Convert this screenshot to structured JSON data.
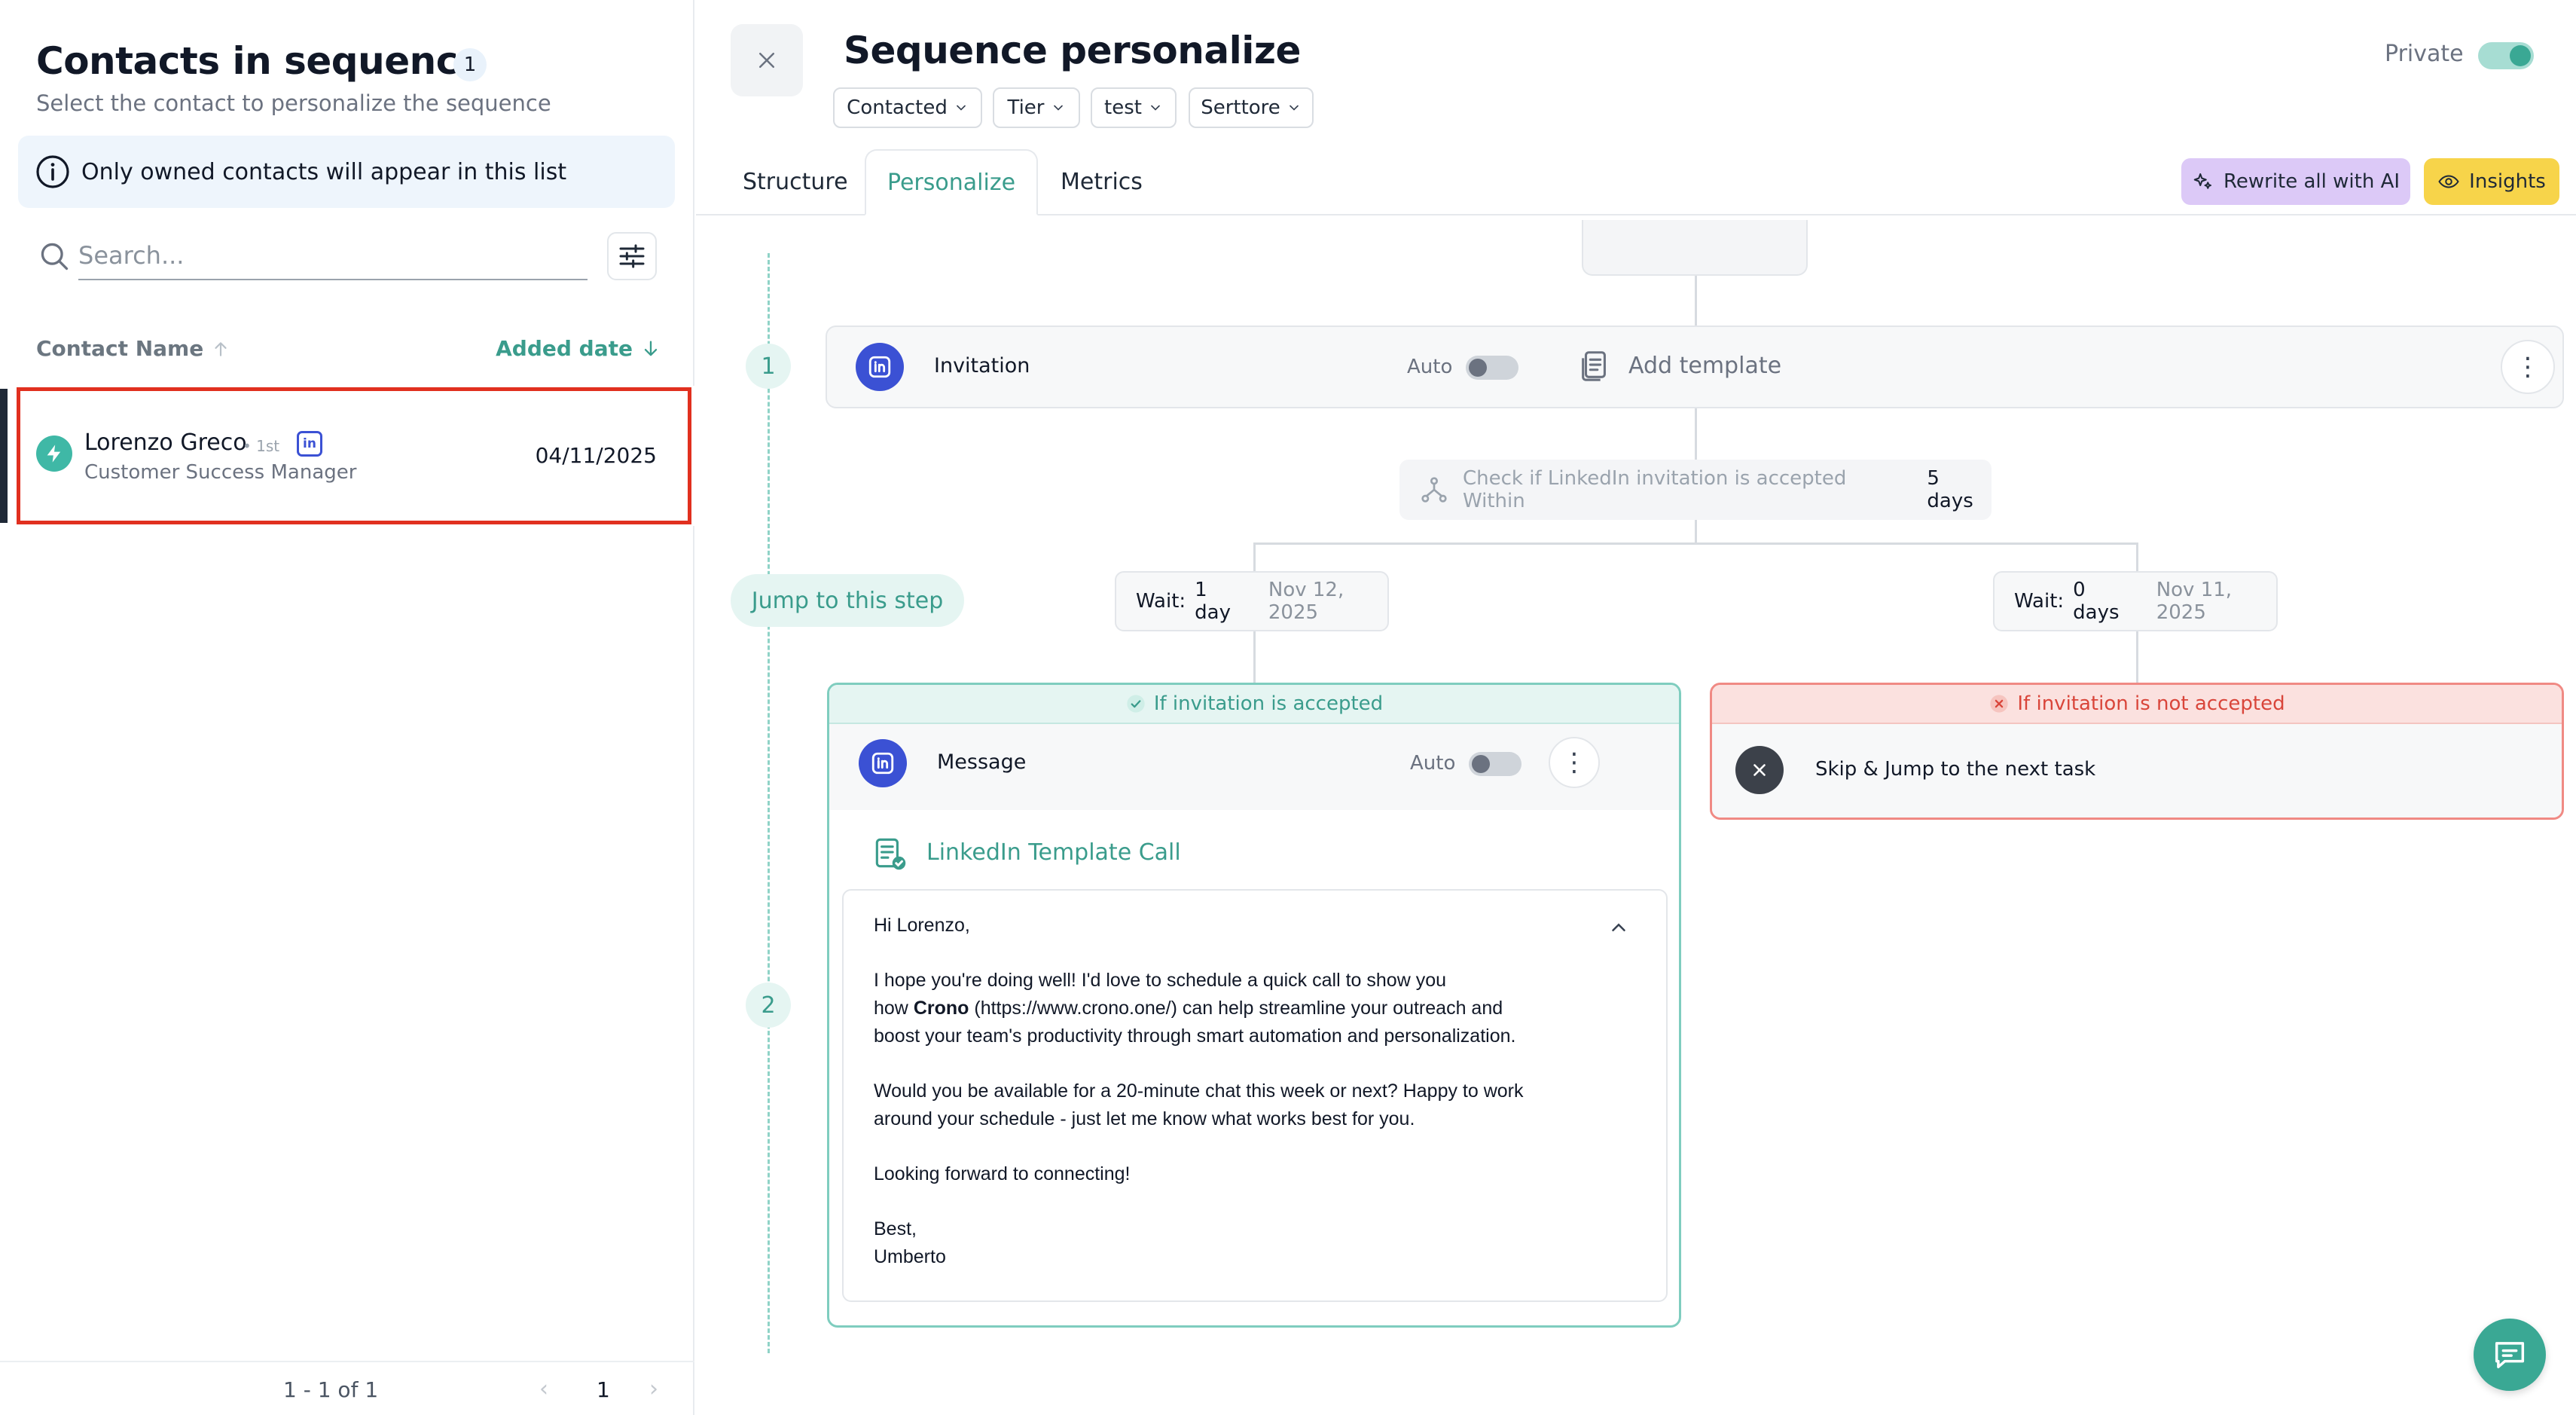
{
  "sidebar": {
    "title": "Contacts in sequence",
    "count": "1",
    "subtitle": "Select the contact to personalize the sequence",
    "info": "Only owned contacts will appear in this list",
    "search_placeholder": "Search...",
    "columns": {
      "name": "Contact Name",
      "date": "Added date"
    },
    "contacts": [
      {
        "name": "Lorenzo Greco",
        "degree": "• 1st",
        "linkedin": "in",
        "role": "Customer Success Manager",
        "added": "04/11/2025"
      }
    ],
    "pagination": {
      "range": "1 - 1 of 1",
      "page": "1",
      "prev": "‹",
      "next": "›"
    }
  },
  "header": {
    "title": "Sequence personalize",
    "chips": [
      "Contacted",
      "Tier",
      "test",
      "Serttore"
    ],
    "private_label": "Private",
    "private_on": true,
    "close": "×"
  },
  "tabs": [
    {
      "label": "Structure",
      "active": false
    },
    {
      "label": "Personalize",
      "active": true
    },
    {
      "label": "Metrics",
      "active": false
    }
  ],
  "actions": {
    "rewrite": "Rewrite all with AI",
    "insights": "Insights"
  },
  "flow": {
    "step1": {
      "number": "1",
      "title": "Invitation",
      "auto_label": "Auto",
      "add_template": "Add template",
      "kebab": "⋮"
    },
    "condition": {
      "text": "Check if LinkedIn invitation is accepted  Within",
      "days": "5 days"
    },
    "jump_label": "Jump to this step",
    "wait_left": {
      "label": "Wait:",
      "value": "1 day",
      "date": "Nov 12, 2025"
    },
    "wait_right": {
      "label": "Wait:",
      "value": "0 days",
      "date": "Nov 11, 2025"
    },
    "accepted": {
      "header": "If invitation is accepted",
      "step_number": "2",
      "title": "Message",
      "auto_label": "Auto",
      "kebab": "⋮",
      "template_name": "LinkedIn Template Call",
      "body": {
        "greeting": "Hi Lorenzo,",
        "p1_line1": "I hope you're doing well! I'd love to schedule a quick call to show you",
        "p1_line2_pre": "how ",
        "p1_line2_bold": "Crono",
        "p1_line2_post": " (https://www.crono.one/) can help streamline your outreach and",
        "p1_line3": "boost your team's productivity through smart automation and personalization.",
        "p2_line1": "Would you be available for a 20-minute chat this week or next? Happy to work",
        "p2_line2": "around your schedule - just let me know what works best for you.",
        "p3": "Looking forward to connecting!",
        "signoff": "Best,",
        "signature": "Umberto"
      }
    },
    "not_accepted": {
      "header": "If invitation is not accepted",
      "action": "Skip & Jump to the next task"
    }
  },
  "colors": {
    "accent": "#3a9c8c",
    "linkedin": "#3b51d4",
    "danger": "#e1301f",
    "ai": "#dcc9f7",
    "insights": "#f7d44a"
  }
}
